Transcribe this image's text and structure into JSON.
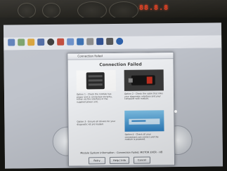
{
  "dashboard": {
    "odometer": "88.8.8"
  },
  "window": {
    "title": "Connection Failed"
  },
  "dialog": {
    "heading": "Connection Failed",
    "options": [
      {
        "text": "Option 1 - Check the module has power and is connected correctly, either via the interface or the supplied power unit."
      },
      {
        "text": "Option 2 - Check the cable that links your diagnostic interface and your computer with module."
      },
      {
        "text": "Option 3 - Ensure all drivers for your diagnostic kit are loaded."
      },
      {
        "text": "Option 4 - Check all your connections are correct and the module is powered."
      }
    ],
    "status": "Module System Information - Connection Failed. MOTOR EVER - HB",
    "buttons": [
      "Retry",
      "Help / Info",
      "Cancel"
    ]
  },
  "colors": {
    "led": "#e23a1c",
    "dialog_bg": "#eef0f3",
    "desktop": "#bfc3cb"
  }
}
